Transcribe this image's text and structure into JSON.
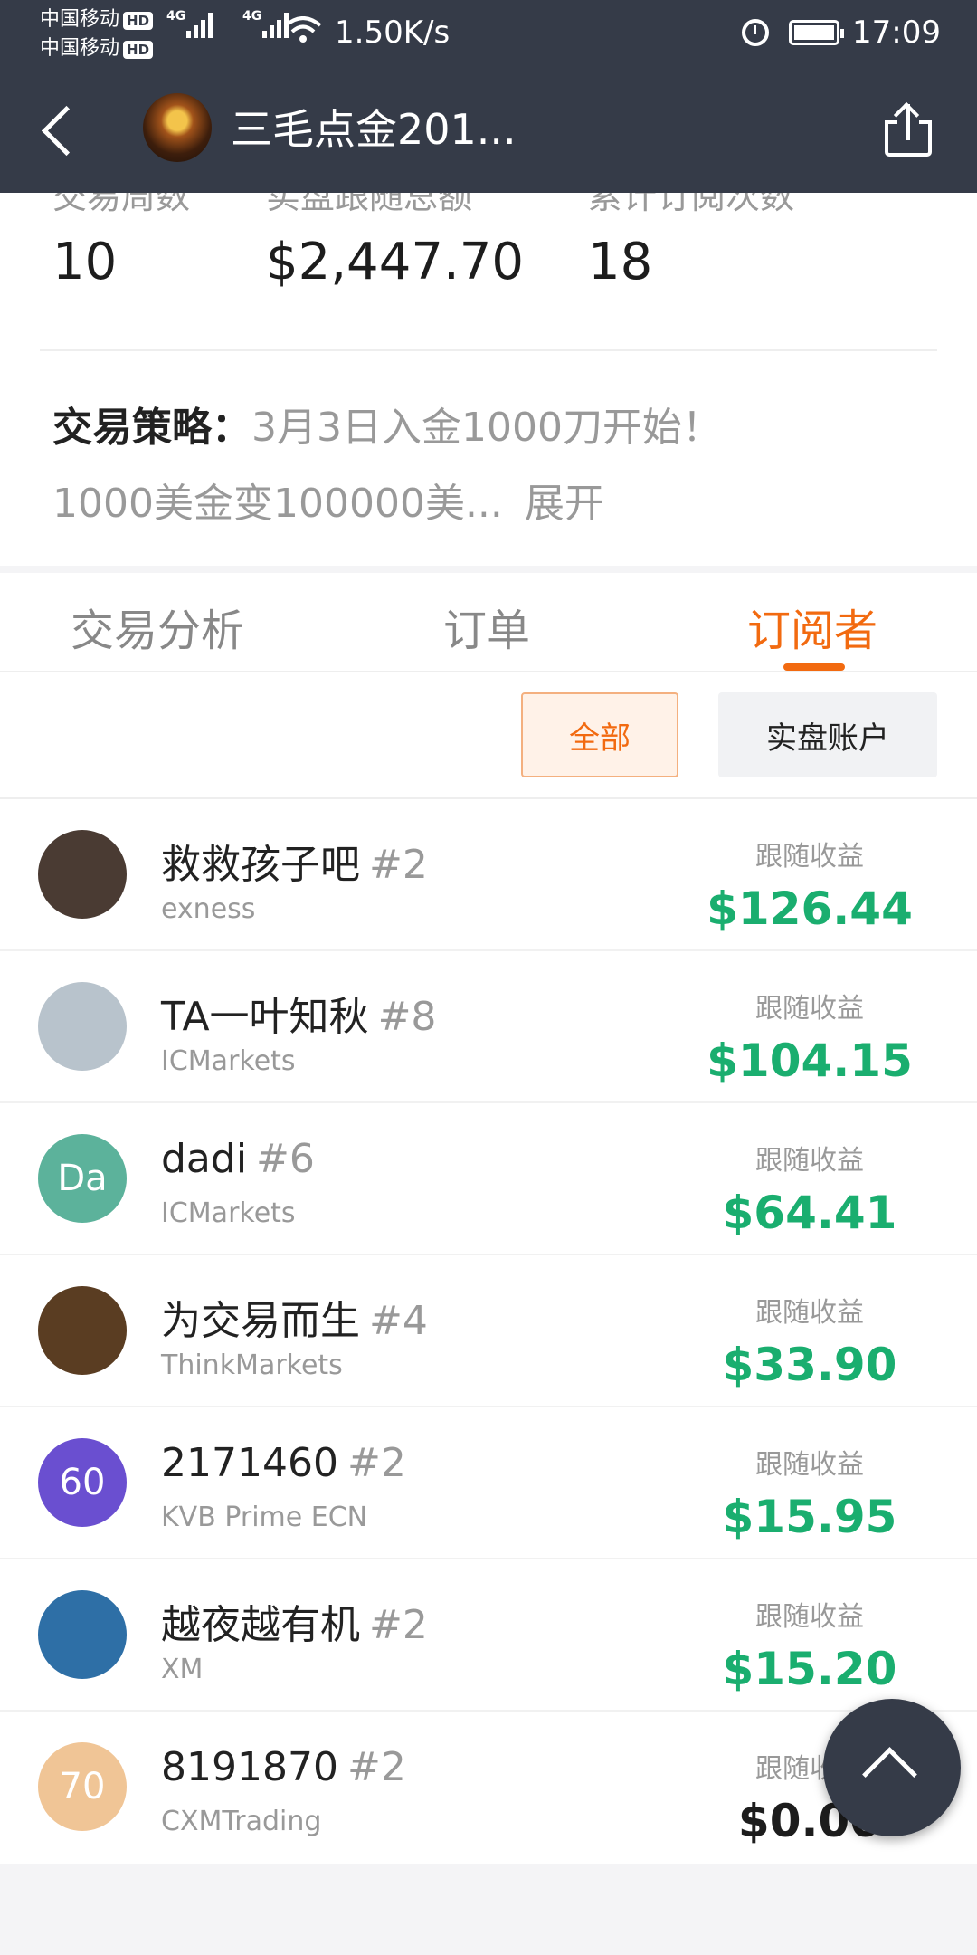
{
  "status_bar": {
    "carrier1": "中国移动",
    "carrier2": "中国移动",
    "hd": "HD",
    "net": "4G",
    "speed": "1.50K/s",
    "time": "17:09"
  },
  "header": {
    "title": "三毛点金201..."
  },
  "stats": [
    {
      "label": "交易周数",
      "value": "10"
    },
    {
      "label": "实盘跟随总额",
      "value": "$2,447.70"
    },
    {
      "label": "累计订阅次数",
      "value": "18"
    }
  ],
  "strategy": {
    "label": "交易策略：",
    "line1": "3月3日入金1000刀开始！",
    "line2": "1000美金变100000美...",
    "expand": "展开"
  },
  "tabs": [
    "交易分析",
    "订单",
    "订阅者"
  ],
  "active_tab": "订阅者",
  "filters": {
    "all": "全部",
    "real": "实盘账户"
  },
  "profit_label": "跟随收益",
  "subscribers": [
    {
      "name": "救救孩子吧",
      "rank": "#2",
      "broker": "exness",
      "profit": "$126.44",
      "avatar_text": "",
      "avatar_color": "#4a3b33"
    },
    {
      "name": "TA一叶知秋",
      "rank": "#8",
      "broker": "ICMarkets",
      "profit": "$104.15",
      "avatar_text": "",
      "avatar_color": "#b8c3cc"
    },
    {
      "name": "dadi",
      "rank": "#6",
      "broker": "ICMarkets",
      "profit": "$64.41",
      "avatar_text": "Da",
      "avatar_color": "#5cb29b"
    },
    {
      "name": "为交易而生",
      "rank": "#4",
      "broker": "ThinkMarkets",
      "profit": "$33.90",
      "avatar_text": "",
      "avatar_color": "#5a3d22"
    },
    {
      "name": "2171460",
      "rank": "#2",
      "broker": "KVB Prime ECN",
      "profit": "$15.95",
      "avatar_text": "60",
      "avatar_color": "#6a4fd0"
    },
    {
      "name": "越夜越有机",
      "rank": "#2",
      "broker": "XM",
      "profit": "$15.20",
      "avatar_text": "",
      "avatar_color": "#2e6fa6"
    },
    {
      "name": "8191870",
      "rank": "#2",
      "broker": "CXMTrading",
      "profit": "$0.00",
      "avatar_text": "70",
      "avatar_color": "#f0c596"
    }
  ],
  "colors": {
    "accent": "#f26a10",
    "profit": "#1aae6f",
    "header_bg": "#353b48"
  }
}
